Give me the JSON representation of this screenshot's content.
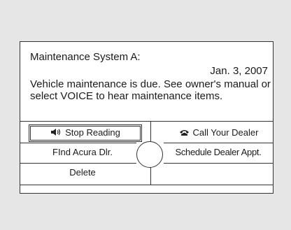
{
  "message": {
    "title": "Maintenance System A:",
    "date": "Jan. 3, 2007",
    "body": "Vehicle maintenance is due. See owner's manual or select VOICE to hear maintenance items."
  },
  "buttons": {
    "stop_reading": "Stop Reading",
    "call_dealer": "Call Your Dealer",
    "find_dealer": "FInd Acura Dlr.",
    "schedule_appt": "Schedule Dealer Appt.",
    "delete": "Delete"
  },
  "icons": {
    "stop_reading": "speaker-icon",
    "call_dealer": "phone-icon"
  },
  "colors": {
    "background": "#e6e6e6",
    "screen": "#ffffff",
    "line": "#333333"
  }
}
